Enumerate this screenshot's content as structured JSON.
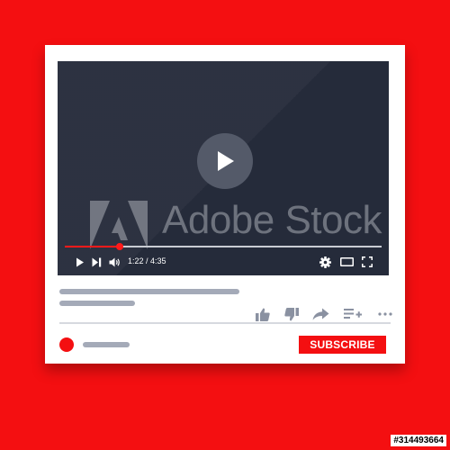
{
  "page": {
    "background_color": "#f40f11"
  },
  "player": {
    "elapsed": "1:22",
    "duration": "4:35",
    "time_separator": " / ",
    "progress_fraction": 0.174,
    "progress_color": "#ff1a1a",
    "screen_color": "#252b3a"
  },
  "watermark": {
    "text": "Adobe Stock"
  },
  "controls": {
    "icons": [
      "play-icon",
      "skip-next-icon",
      "volume-icon",
      "gear-icon",
      "theater-mode-icon",
      "fullscreen-icon"
    ]
  },
  "actions": {
    "icons": [
      "thumbs-up-icon",
      "thumbs-down-icon",
      "share-icon",
      "add-to-playlist-icon",
      "more-options-icon"
    ]
  },
  "subscribe": {
    "label": "SUBSCRIBE",
    "color": "#f40f11"
  },
  "stock_id": "#314493664"
}
